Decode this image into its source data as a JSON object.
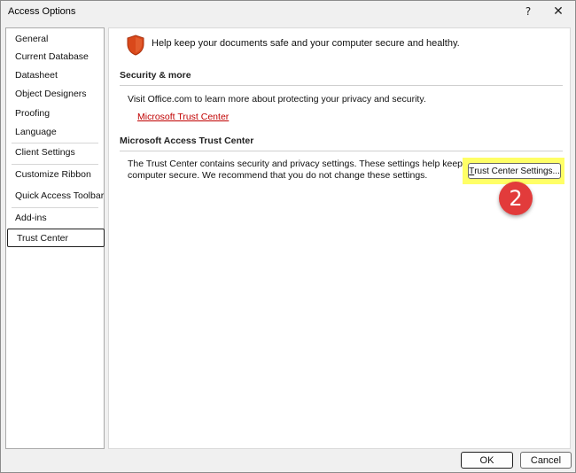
{
  "window": {
    "title": "Access Options",
    "help_glyph": "?",
    "close_glyph": "✕"
  },
  "nav": {
    "items": [
      {
        "label": "General"
      },
      {
        "label": "Current Database"
      },
      {
        "label": "Datasheet"
      },
      {
        "label": "Object Designers"
      },
      {
        "label": "Proofing"
      },
      {
        "label": "Language"
      },
      {
        "label": "Client Settings"
      },
      {
        "label": "Customize Ribbon"
      },
      {
        "label": "Quick Access Toolbar"
      },
      {
        "label": "Add-ins"
      },
      {
        "label": "Trust Center",
        "selected": true
      }
    ]
  },
  "content": {
    "header_icon": "shield-icon",
    "header_text": "Help keep your documents safe and your computer secure and healthy.",
    "security_section": {
      "title": "Security & more",
      "body": "Visit Office.com to learn more about protecting your privacy and security.",
      "link": "Microsoft Trust Center"
    },
    "trust_center_section": {
      "title": "Microsoft Access Trust Center",
      "body_line1": "The Trust Center contains security and privacy settings. These settings help keep your",
      "body_line2": "computer secure. We recommend that you do not change these settings.",
      "button_mnemonic": "T",
      "button_rest": "rust Center Settings..."
    },
    "annotation_badge": "2"
  },
  "footer": {
    "ok_label": "OK",
    "cancel_label": "Cancel"
  },
  "colors": {
    "link": "#c00000",
    "highlight": "#ffff66",
    "badge": "#e23b3b",
    "shield": "#d9481b"
  }
}
